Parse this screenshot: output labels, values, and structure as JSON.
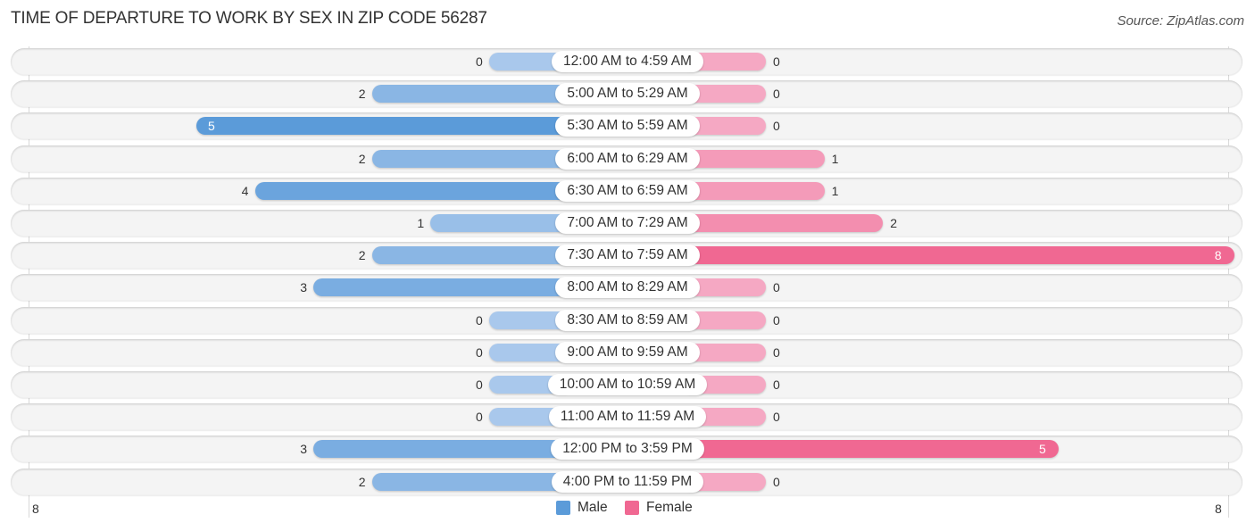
{
  "header": {
    "title": "TIME OF DEPARTURE TO WORK BY SEX IN ZIP CODE 56287",
    "source": "Source: ZipAtlas.com"
  },
  "colors": {
    "male_light": "#a9c8ec",
    "male_dark": "#5b9bd9",
    "female_light": "#f5a8c3",
    "female_dark": "#f06892",
    "row_bg": "#f4f4f4"
  },
  "legend": {
    "male_label": "Male",
    "female_label": "Female"
  },
  "axis": {
    "left_tick": "8",
    "right_tick": "8"
  },
  "chart_data": {
    "type": "bar",
    "orientation": "horizontal-diverging",
    "title": "TIME OF DEPARTURE TO WORK BY SEX IN ZIP CODE 56287",
    "source": "Source: ZipAtlas.com",
    "xlim": [
      -8,
      8
    ],
    "xtick_labels": [
      "8",
      "8"
    ],
    "legend_position": "bottom-center",
    "categories": [
      "12:00 AM to 4:59 AM",
      "5:00 AM to 5:29 AM",
      "5:30 AM to 5:59 AM",
      "6:00 AM to 6:29 AM",
      "6:30 AM to 6:59 AM",
      "7:00 AM to 7:29 AM",
      "7:30 AM to 7:59 AM",
      "8:00 AM to 8:29 AM",
      "8:30 AM to 8:59 AM",
      "9:00 AM to 9:59 AM",
      "10:00 AM to 10:59 AM",
      "11:00 AM to 11:59 AM",
      "12:00 PM to 3:59 PM",
      "4:00 PM to 11:59 PM"
    ],
    "series": [
      {
        "name": "Male",
        "side": "left",
        "values": [
          0,
          2,
          5,
          2,
          4,
          1,
          2,
          3,
          0,
          0,
          0,
          0,
          3,
          2
        ]
      },
      {
        "name": "Female",
        "side": "right",
        "values": [
          0,
          0,
          0,
          1,
          1,
          2,
          8,
          0,
          0,
          0,
          0,
          0,
          5,
          0
        ]
      }
    ]
  }
}
